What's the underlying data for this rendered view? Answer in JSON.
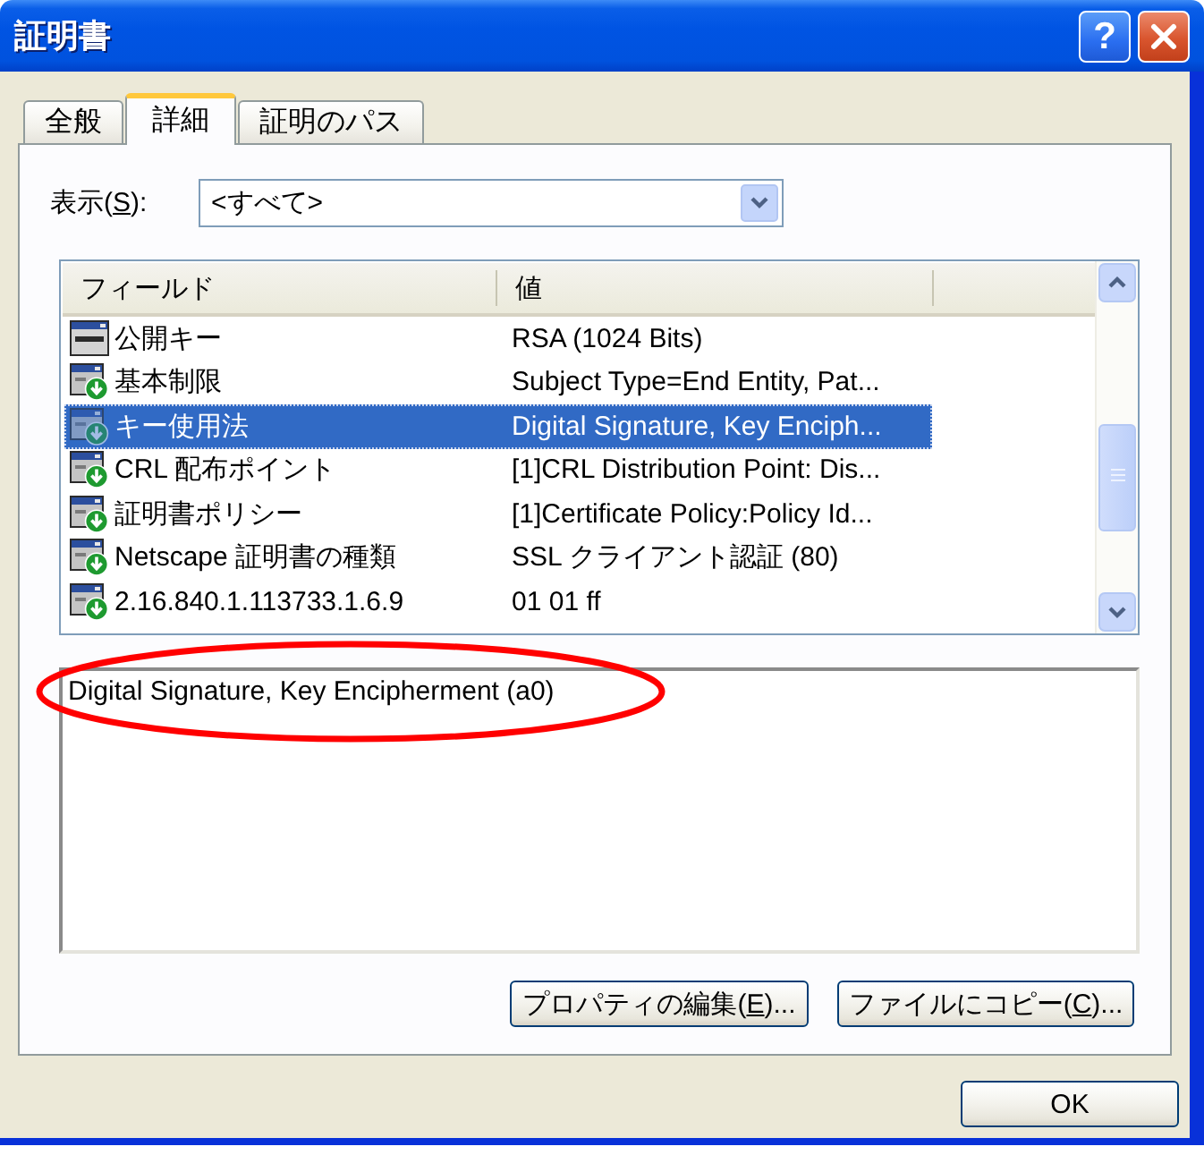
{
  "window": {
    "title": "証明書",
    "title_buttons": [
      {
        "kind": "help",
        "label": "?"
      },
      {
        "kind": "close"
      }
    ]
  },
  "tabs": [
    {
      "label": "全般",
      "selected": false
    },
    {
      "label": "詳細",
      "selected": true
    },
    {
      "label": "証明のパス",
      "selected": false
    }
  ],
  "view_filter": {
    "label": {
      "pre": "表示(",
      "key": "S",
      "post": "):"
    },
    "value": "<すべて>"
  },
  "field_list": {
    "columns": [
      "フィールド",
      "値"
    ],
    "rows": [
      {
        "kind": "field",
        "field": "公開キー",
        "value": "RSA (1024 Bits)",
        "selected": false
      },
      {
        "kind": "extension",
        "field": "基本制限",
        "value": "Subject Type=End Entity, Pat...",
        "selected": false
      },
      {
        "kind": "extension",
        "field": "キー使用法",
        "value": "Digital Signature, Key Enciph...",
        "selected": true
      },
      {
        "kind": "extension",
        "field": "CRL 配布ポイント",
        "value": "[1]CRL Distribution Point: Dis...",
        "selected": false
      },
      {
        "kind": "extension",
        "field": "証明書ポリシー",
        "value": "[1]Certificate Policy:Policy Id...",
        "selected": false
      },
      {
        "kind": "extension",
        "field": "Netscape 証明書の種類",
        "value": "SSL クライアント認証 (80)",
        "selected": false
      },
      {
        "kind": "extension",
        "field": "2.16.840.1.113733.1.6.9",
        "value": "01 01 ff",
        "selected": false
      }
    ]
  },
  "detail": {
    "value": "Digital Signature, Key Encipherment (a0)"
  },
  "annotation": {
    "kind": "ellipse"
  },
  "buttons": [
    {
      "label": {
        "pre": "プロパティの編集(",
        "key": "E",
        "post": ")..."
      }
    },
    {
      "label": {
        "pre": "ファイルにコピー(",
        "key": "C",
        "post": ")..."
      }
    }
  ],
  "ok_button": {
    "label": "OK"
  }
}
